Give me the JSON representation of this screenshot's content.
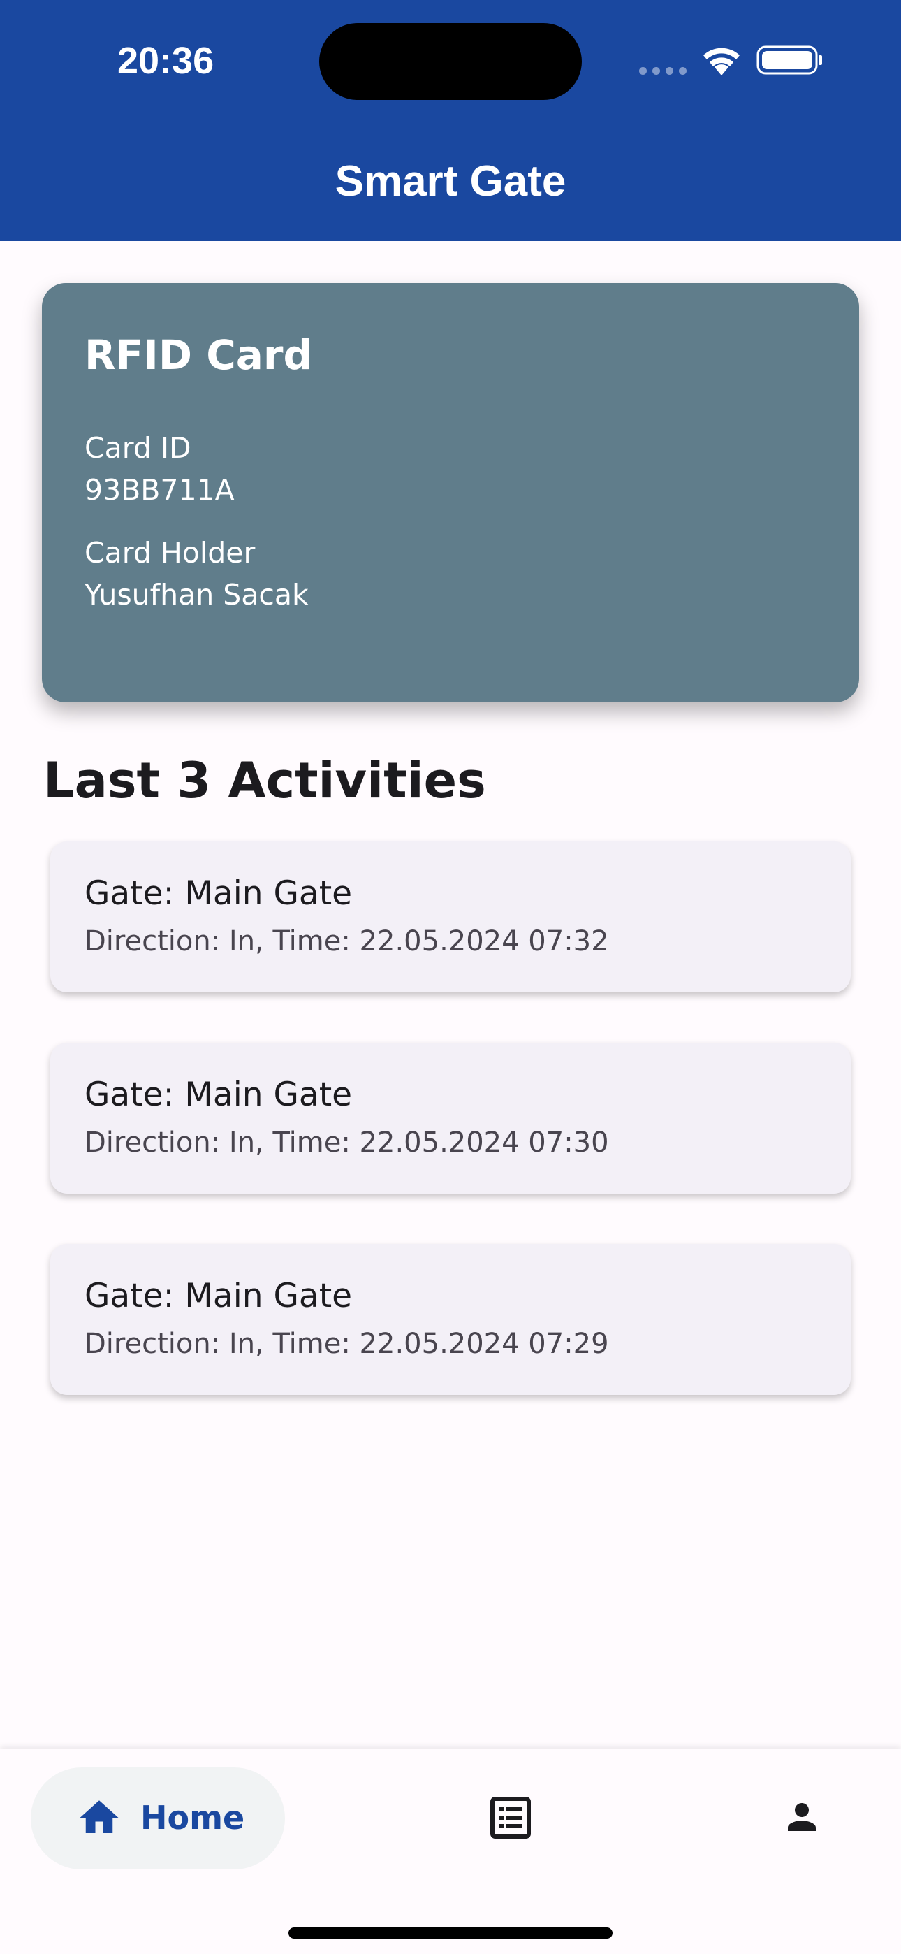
{
  "status_bar": {
    "time": "20:36",
    "icons": [
      "cellular-signal-icon",
      "wifi-icon",
      "battery-icon"
    ]
  },
  "app_bar": {
    "title": "Smart Gate",
    "background_color": "#1A48A0"
  },
  "rfid_card": {
    "title": "RFID Card",
    "card_id_label": "Card ID",
    "card_id_value": "93BB711A",
    "card_holder_label": "Card Holder",
    "card_holder_value": "Yusufhan Sacak",
    "background_color": "#607D8B"
  },
  "activities": {
    "title": "Last 3 Activities",
    "items": [
      {
        "gate": "Gate: Main Gate",
        "detail": "Direction: In, Time: 22.05.2024 07:32"
      },
      {
        "gate": "Gate: Main Gate",
        "detail": "Direction: In, Time: 22.05.2024 07:30"
      },
      {
        "gate": "Gate: Main Gate",
        "detail": "Direction: In, Time: 22.05.2024 07:29"
      }
    ]
  },
  "bottom_nav": {
    "items": [
      {
        "label": "Home",
        "icon": "home-icon",
        "selected": true
      },
      {
        "label": "",
        "icon": "list-icon",
        "selected": false
      },
      {
        "label": "",
        "icon": "person-icon",
        "selected": false
      }
    ],
    "accent_color": "#1A48A0"
  }
}
